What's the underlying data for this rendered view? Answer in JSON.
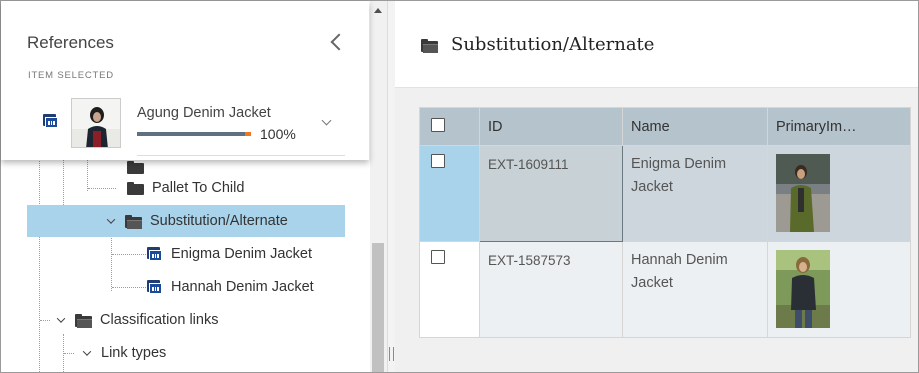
{
  "references": {
    "title": "References",
    "subtitle": "ITEM SELECTED",
    "item_name": "Agung Denim Jacket",
    "progress_text": "100%",
    "progress_value": 1.0
  },
  "tree": {
    "nodes": [
      {
        "label": "Pallet To Child",
        "icon": "folder-icon"
      },
      {
        "label": "Substitution/Alternate",
        "icon": "folder-open-icon"
      },
      {
        "label": "Enigma Denim Jacket",
        "icon": "item-icon"
      },
      {
        "label": "Hannah Denim Jacket",
        "icon": "item-icon"
      },
      {
        "label": "Classification links",
        "icon": "folder-open-icon"
      },
      {
        "label": "Link types",
        "icon": "chevron-down-icon"
      }
    ]
  },
  "right": {
    "title": "Substitution/Alternate",
    "columns": [
      "",
      "ID",
      "Name",
      "PrimaryIm…"
    ],
    "rows": [
      {
        "id": "EXT-1609111",
        "name": "Enigma Denim Jacket"
      },
      {
        "id": "EXT-1587573",
        "name": "Hannah Denim Jacket"
      }
    ]
  },
  "colors": {
    "selection": "#a9d3ea",
    "header_bg": "#b4c3cc",
    "progress_bar": "#607080",
    "progress_accent": "#f2761e",
    "item_icon": "#1c4a9a"
  }
}
